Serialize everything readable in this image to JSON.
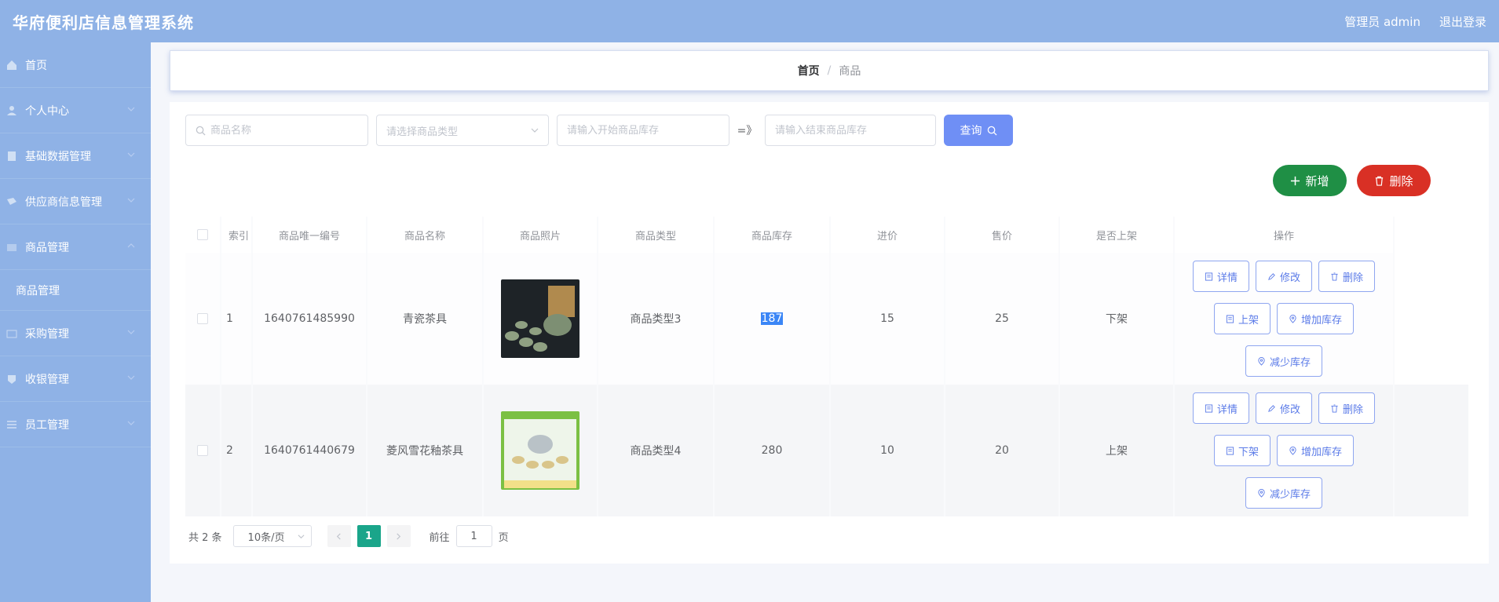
{
  "header": {
    "title": "华府便利店信息管理系统",
    "user": "管理员 admin",
    "logout": "退出登录"
  },
  "sidebar": {
    "items": [
      {
        "label": "首页",
        "icon": "home-icon"
      },
      {
        "label": "个人中心",
        "icon": "user-icon"
      },
      {
        "label": "基础数据管理",
        "icon": "database-icon"
      },
      {
        "label": "供应商信息管理",
        "icon": "truck-icon"
      },
      {
        "label": "商品管理",
        "icon": "goods-icon"
      },
      {
        "label": "采购管理",
        "icon": "cart-icon"
      },
      {
        "label": "收银管理",
        "icon": "cashier-icon"
      },
      {
        "label": "员工管理",
        "icon": "staff-icon"
      }
    ],
    "submenu": "商品管理"
  },
  "breadcrumb": {
    "home": "首页",
    "separator": "/",
    "current": "商品"
  },
  "search": {
    "name_placeholder": "商品名称",
    "type_placeholder": "请选择商品类型",
    "stock_start_placeholder": "请输入开始商品库存",
    "range_sep": "=》",
    "stock_end_placeholder": "请输入结束商品库存",
    "query_label": "查询"
  },
  "actions": {
    "add_label": "新增",
    "delete_label": "删除"
  },
  "table": {
    "headers": [
      "索引",
      "商品唯一编号",
      "商品名称",
      "商品照片",
      "商品类型",
      "商品库存",
      "进价",
      "售价",
      "是否上架",
      "操作"
    ],
    "rows": [
      {
        "index": "1",
        "code": "1640761485990",
        "name": "青瓷茶具",
        "type": "商品类型3",
        "stock": "187",
        "price_in": "15",
        "price_out": "25",
        "shelf": "下架",
        "toggle": "上架"
      },
      {
        "index": "2",
        "code": "1640761440679",
        "name": "菱风雪花釉茶具",
        "type": "商品类型4",
        "stock": "280",
        "price_in": "10",
        "price_out": "20",
        "shelf": "上架",
        "toggle": "下架"
      }
    ],
    "ops": {
      "detail": "详情",
      "edit": "修改",
      "delete": "删除",
      "add_stock": "增加库存",
      "reduce_stock": "减少库存"
    }
  },
  "pagination": {
    "total": "共 2 条",
    "page_size": "10条/页",
    "current": "1",
    "goto_label": "前往",
    "goto_value": "1",
    "page_unit": "页"
  },
  "colors": {
    "header_bg": "#8fb2e6",
    "accent": "#6f8ff5",
    "add": "#1f8f45",
    "delete": "#d93025",
    "page_active": "#1aa58a"
  }
}
